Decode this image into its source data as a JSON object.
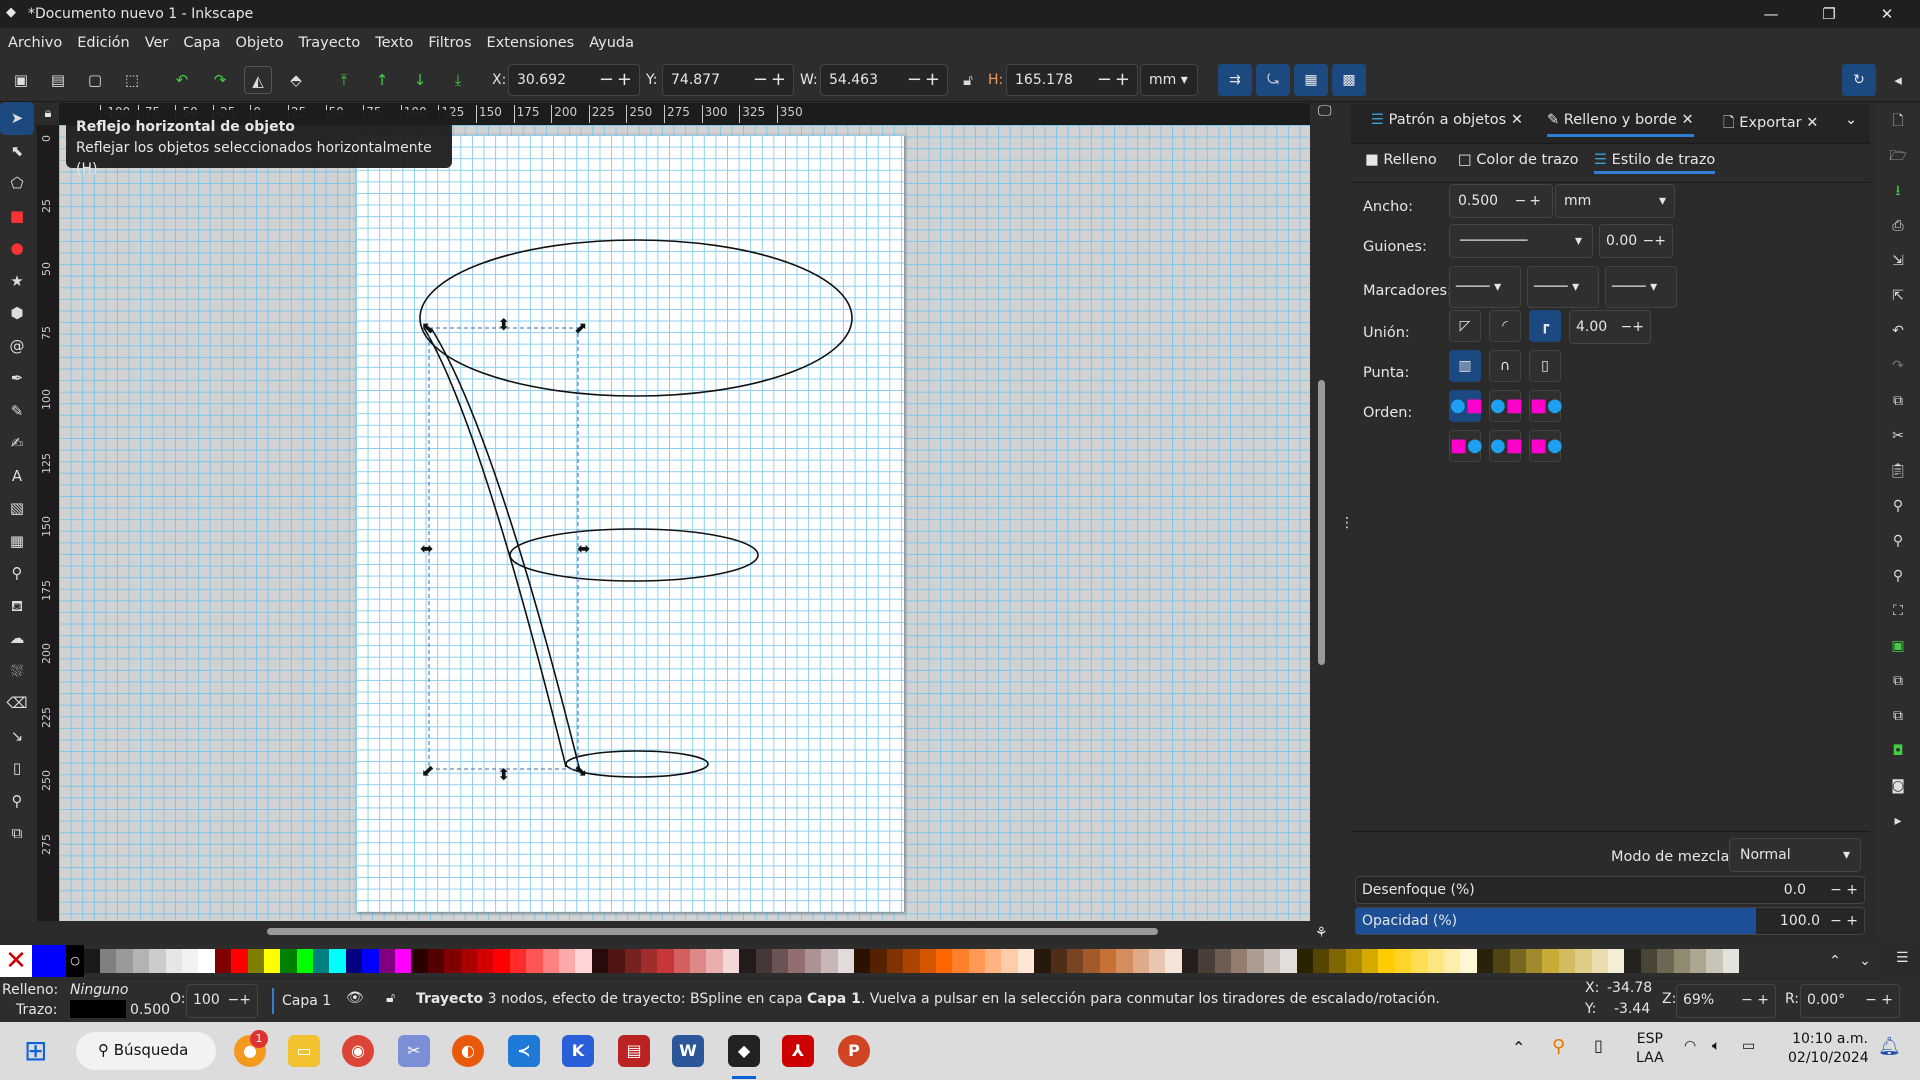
{
  "window": {
    "title": "*Documento nuevo 1 - Inkscape",
    "minimize": "—",
    "maximize": "❐",
    "close": "✕"
  },
  "menu": [
    "Archivo",
    "Edición",
    "Ver",
    "Capa",
    "Objeto",
    "Trayecto",
    "Texto",
    "Filtros",
    "Extensiones",
    "Ayuda"
  ],
  "toolbar": {
    "x_label": "X:",
    "x": "30.692",
    "y_label": "Y:",
    "y": "74.877",
    "w_label": "W:",
    "w": "54.463",
    "h_label": "H:",
    "h": "165.178",
    "unit": "mm",
    "minus": "−",
    "plus": "+"
  },
  "tooltip": {
    "title": "Reflejo horizontal de objeto",
    "text": "Reflejar los objetos seleccionados horizontalmente (H)"
  },
  "ruler": {
    "h_ticks": [
      "-100",
      "-75",
      "-50",
      "-25",
      "0",
      "25",
      "50",
      "75",
      "100",
      "125",
      "150",
      "175",
      "200",
      "225",
      "250",
      "275",
      "300",
      "325",
      "350"
    ],
    "v_ticks": [
      "0",
      "25",
      "50",
      "75",
      "100",
      "125",
      "150",
      "175",
      "200",
      "225",
      "250",
      "275"
    ]
  },
  "dock": {
    "tabs": [
      {
        "label": "Patrón a objetos"
      },
      {
        "label": "Relleno y borde"
      },
      {
        "label": "Exportar"
      }
    ],
    "subtabs": [
      {
        "label": "Relleno"
      },
      {
        "label": "Color de trazo"
      },
      {
        "label": "Estilo de trazo"
      }
    ],
    "ancho_label": "Ancho:",
    "ancho": "0.500",
    "ancho_unit": "mm",
    "guiones_label": "Guiones:",
    "guiones_offset": "0.00",
    "marcadores_label": "Marcadores:",
    "union_label": "Unión:",
    "miter": "4.00",
    "punta_label": "Punta:",
    "orden_label": "Orden:",
    "blend_label": "Modo de mezcla:",
    "blend": "Normal",
    "blur_label": "Desenfoque (%)",
    "blur": "0.0",
    "opacity_label": "Opacidad (%)",
    "opacity": "100.0",
    "accent": "#1c4a80"
  },
  "palette": [
    "#808080",
    "#9a9a9a",
    "#b3b3b3",
    "#cccccc",
    "#e6e6e6",
    "#f2f2f2",
    "#ffffff",
    "#800000",
    "#ff0000",
    "#808000",
    "#ffff00",
    "#008000",
    "#00ff00",
    "#008080",
    "#00ffff",
    "#000080",
    "#0000ff",
    "#800080",
    "#ff00ff",
    "#2b0000",
    "#550000",
    "#800000",
    "#aa0000",
    "#d40000",
    "#ff0000",
    "#ff2a2a",
    "#ff5555",
    "#ff8080",
    "#ffaaaa",
    "#ffd5d5",
    "#280b0b",
    "#501616",
    "#782121",
    "#a02c2c",
    "#c83737",
    "#d35f5f",
    "#de8787",
    "#e9afaf",
    "#f4d7d7",
    "#241c1c",
    "#483737",
    "#6c5353",
    "#916f6f",
    "#ac9393",
    "#c8b7b7",
    "#e3dbdb",
    "#2b1100",
    "#552200",
    "#803300",
    "#aa4400",
    "#d45500",
    "#ff6600",
    "#ff7f2a",
    "#ff9955",
    "#ffb380",
    "#ffccaa",
    "#ffe6d5",
    "#28170b",
    "#502d16",
    "#784421",
    "#a05a2c",
    "#c87137",
    "#d38d5f",
    "#deaa87",
    "#e9c6af",
    "#f4e3d7",
    "#241f1c",
    "#483e37",
    "#6c5d53",
    "#917c6f",
    "#ac9d93",
    "#c8beb7",
    "#e3dedb",
    "#2b2200",
    "#554400",
    "#806600",
    "#aa8800",
    "#d4aa00",
    "#ffcc00",
    "#ffd42a",
    "#ffdd55",
    "#ffe680",
    "#ffeeaa",
    "#fff6d5",
    "#28220b",
    "#504416",
    "#786721",
    "#a0892c",
    "#c8ab37",
    "#d3bc5f",
    "#decd87",
    "#e9ddaf",
    "#f4eed7",
    "#24221c",
    "#484537",
    "#6c6753",
    "#918a6f",
    "#aca793",
    "#c8c4b7",
    "#e3e2db"
  ],
  "status": {
    "fill_label": "Relleno:",
    "fill": "Ninguno",
    "stroke_label": "Trazo:",
    "stroke_width": "0.500",
    "opacity_label": "O:",
    "opacity": "100",
    "layer": "Capa 1",
    "msg_obj": "Trayecto",
    "msg_1": " 3 nodos, efecto de trayecto: BSpline en capa ",
    "msg_layer": "Capa 1",
    "msg_2": ". Vuelva a pulsar en la selección para conmutar los tiradores de escalado/rotación.",
    "cx_label": "X:",
    "cx": "-34.78",
    "cy_label": "Y:",
    "cy": "-3.44",
    "zoom_label": "Z:",
    "zoom": "69%",
    "rot_label": "R:",
    "rot": "0.00°"
  },
  "taskbar": {
    "search": "Búsqueda",
    "badge": "1",
    "lang1": "ESP",
    "lang2": "LAA",
    "time": "10:10 a.m.",
    "date": "02/10/2024"
  }
}
